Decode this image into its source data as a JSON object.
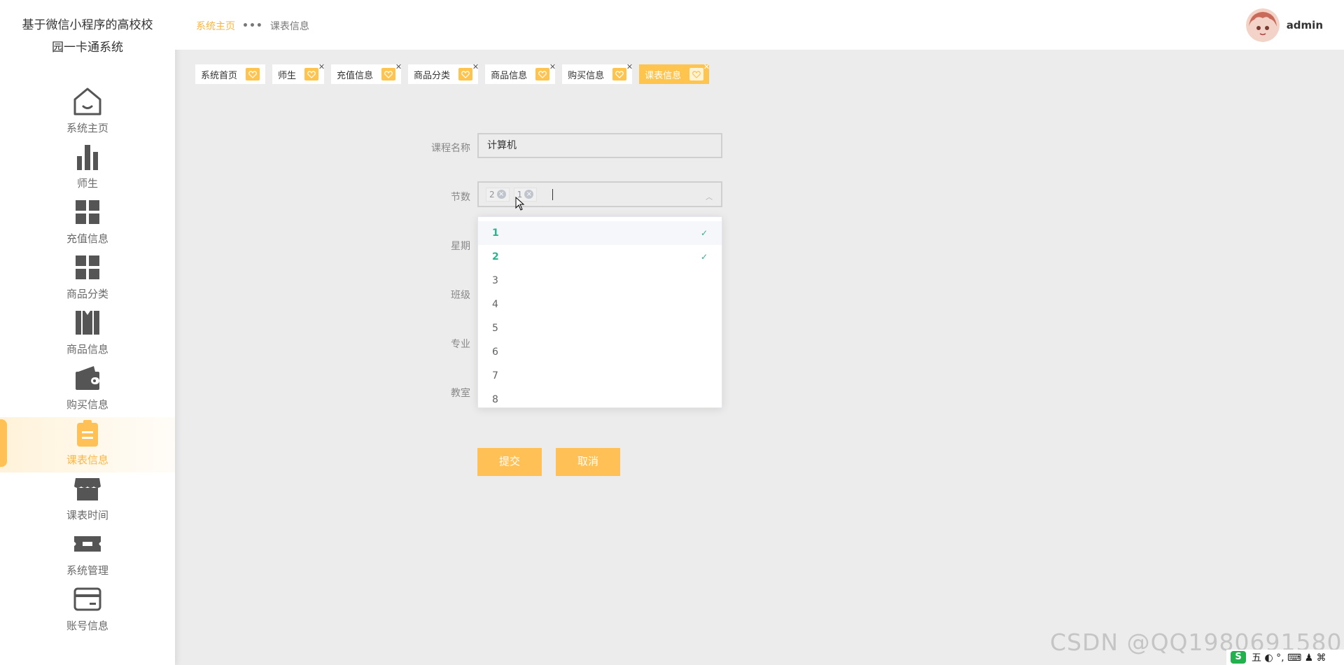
{
  "app": {
    "title_line1": "基于微信小程序的高校校",
    "title_line2": "园一卡通系统"
  },
  "sidebar": {
    "items": [
      {
        "label": "系统主页",
        "icon": "home-icon"
      },
      {
        "label": "师生",
        "icon": "bar-chart-icon"
      },
      {
        "label": "充值信息",
        "icon": "grid-icon"
      },
      {
        "label": "商品分类",
        "icon": "grid-icon"
      },
      {
        "label": "商品信息",
        "icon": "books-icon"
      },
      {
        "label": "购买信息",
        "icon": "wallet-icon"
      },
      {
        "label": "课表信息",
        "icon": "clipboard-icon",
        "active": true
      },
      {
        "label": "课表时间",
        "icon": "shop-icon"
      },
      {
        "label": "系统管理",
        "icon": "ticket-icon"
      },
      {
        "label": "账号信息",
        "icon": "card-icon"
      }
    ]
  },
  "header": {
    "breadcrumb_home": "系统主页",
    "breadcrumb_sep": "•••",
    "breadcrumb_current": "课表信息",
    "username": "admin"
  },
  "tabs": [
    {
      "label": "系统首页",
      "closable": false
    },
    {
      "label": "师生",
      "closable": true
    },
    {
      "label": "充值信息",
      "closable": true
    },
    {
      "label": "商品分类",
      "closable": true
    },
    {
      "label": "商品信息",
      "closable": true
    },
    {
      "label": "购买信息",
      "closable": true
    },
    {
      "label": "课表信息",
      "closable": true,
      "active": true
    }
  ],
  "form": {
    "course_name_label": "课程名称",
    "course_name_value": "计算机",
    "section_label": "节数",
    "section_tags": [
      "2",
      "1"
    ],
    "week_label": "星期",
    "class_label": "班级",
    "major_label": "专业",
    "room_label": "教室",
    "submit_label": "提交",
    "cancel_label": "取消"
  },
  "dropdown": {
    "options": [
      {
        "label": "1",
        "selected": true
      },
      {
        "label": "2",
        "selected": true
      },
      {
        "label": "3",
        "selected": false
      },
      {
        "label": "4",
        "selected": false
      },
      {
        "label": "5",
        "selected": false
      },
      {
        "label": "6",
        "selected": false
      },
      {
        "label": "7",
        "selected": false
      },
      {
        "label": "8",
        "selected": false
      }
    ],
    "check_glyph": "✓"
  },
  "watermark": "CSDN @QQ1980691580",
  "tray": {
    "s": "S",
    "text": "五 ◐ °, ⌨ ♟ ⌘"
  },
  "colors": {
    "accent": "#ffc155",
    "selected_option": "#2bb38f",
    "background": "#ececec"
  }
}
